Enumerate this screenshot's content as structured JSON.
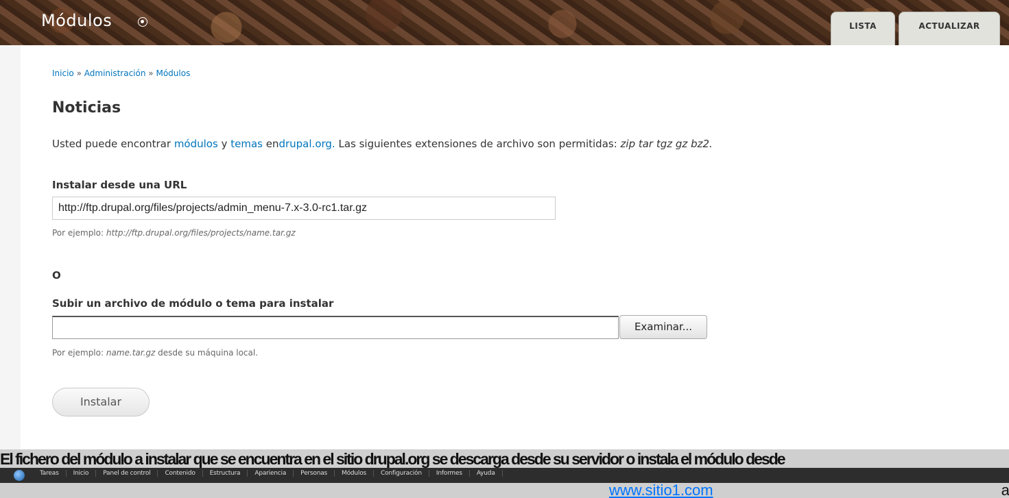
{
  "header": {
    "title": "Módulos",
    "tabs": [
      "LISTA",
      "ACTUALIZAR"
    ]
  },
  "breadcrumb": {
    "items": [
      "Inicio",
      "Administración",
      "Módulos"
    ],
    "separator": "»"
  },
  "main": {
    "section_title": "Noticias",
    "help": {
      "prefix": "Usted puede encontrar ",
      "modules_link": "módulos",
      "and": " y ",
      "themes_link": "temas",
      "en": " en",
      "drupal_link": "drupal.org.",
      "suffix": " Las siguientes extensiones de archivo son permitidas: ",
      "extensions": "zip tar tgz gz bz2."
    },
    "url_install": {
      "label": "Instalar desde una URL",
      "value": "http://ftp.drupal.org/files/projects/admin_menu-7.x-3.0-rc1.tar.gz",
      "description_prefix": "Por ejemplo: ",
      "description_example": "http://ftp.drupal.org/files/projects/name.tar.gz"
    },
    "or_label": "O",
    "upload": {
      "label": "Subir un archivo de módulo o tema para instalar",
      "browse_label": "Examinar...",
      "description_prefix": "Por ejemplo: ",
      "description_example": "name.tar.gz",
      "description_suffix": " desde su máquina local."
    },
    "install_button": "Instalar"
  },
  "footer": {
    "garbled_text": "El fichero del módulo a instalar que se encuentra en el sitio drupal.org se descarga desde su servidor o instala el módulo desde",
    "toolbar_items": [
      "Tareas",
      "Inicio",
      "Panel de control",
      "Contenido",
      "Estructura",
      "Apariencia",
      "Personas",
      "Módulos",
      "Configuración",
      "Informes",
      "Ayuda"
    ],
    "site_link": "www.sitio1.com",
    "trailing_text": "able"
  },
  "colors": {
    "link": "#0074bd",
    "header_bg": "#4a2e1c",
    "tab_bg": "#e1e2dc"
  }
}
